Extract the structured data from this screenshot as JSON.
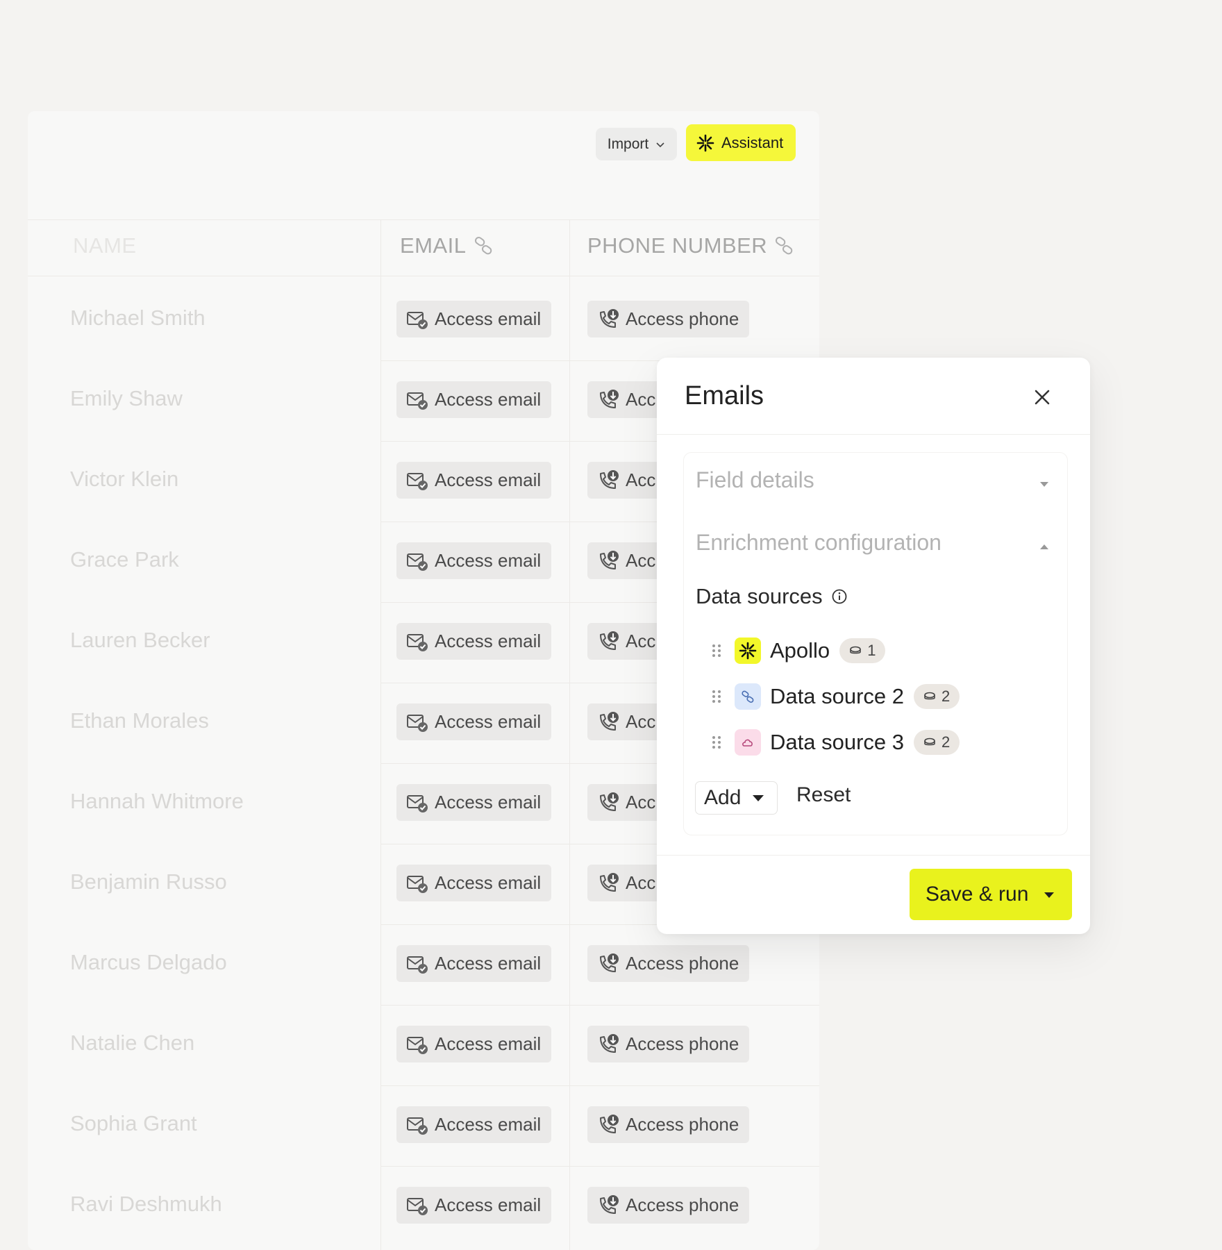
{
  "toolbar": {
    "import_label": "Import",
    "assistant_label": "Assistant",
    "accent": "#f5f73a"
  },
  "table": {
    "columns": {
      "name": "NAME",
      "email": "EMAIL",
      "phone": "PHONE NUMBER"
    },
    "email_action": "Access email",
    "phone_action": "Access phone",
    "phone_action_truncated": "Acc",
    "rows": [
      {
        "name": "Michael Smith"
      },
      {
        "name": "Emily Shaw"
      },
      {
        "name": "Victor Klein"
      },
      {
        "name": "Grace Park"
      },
      {
        "name": "Lauren Becker"
      },
      {
        "name": "Ethan Morales"
      },
      {
        "name": "Hannah Whitmore"
      },
      {
        "name": "Benjamin Russo"
      },
      {
        "name": "Marcus Delgado"
      },
      {
        "name": "Natalie Chen"
      },
      {
        "name": "Sophia Grant"
      },
      {
        "name": "Ravi Deshmukh"
      }
    ]
  },
  "modal": {
    "title": "Emails",
    "sections": {
      "field_details": "Field details",
      "enrichment_configuration": "Enrichment configuration"
    },
    "data_sources_title": "Data sources",
    "data_sources": [
      {
        "label": "Apollo",
        "count": "1",
        "icon": "apollo-asterisk-icon",
        "icon_bg": "#f2f72a"
      },
      {
        "label": "Data source 2",
        "count": "2",
        "icon": "link-icon",
        "icon_bg": "#dce8fb"
      },
      {
        "label": "Data source 3",
        "count": "2",
        "icon": "cloud-icon",
        "icon_bg": "#fbdce9"
      }
    ],
    "add_label": "Add",
    "reset_label": "Reset",
    "save_label": "Save & run",
    "save_color": "#e9f21d"
  }
}
